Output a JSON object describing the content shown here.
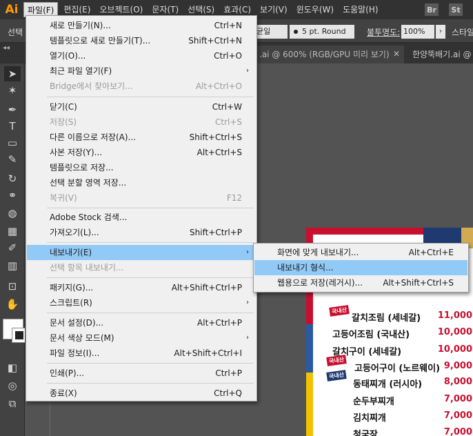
{
  "app": {
    "logo_text": "Ai"
  },
  "menubar": {
    "items": [
      {
        "label": "파일(F)",
        "active": true
      },
      {
        "label": "편집(E)"
      },
      {
        "label": "오브젝트(O)"
      },
      {
        "label": "문자(T)"
      },
      {
        "label": "선택(S)"
      },
      {
        "label": "효과(C)"
      },
      {
        "label": "보기(V)"
      },
      {
        "label": "윈도우(W)"
      },
      {
        "label": "도움말(H)"
      }
    ],
    "bridge_label": "Br",
    "stock_label": "St"
  },
  "controlbar": {
    "selection_label": "선택",
    "uniform_value": "균일",
    "brush_value": "5 pt. Round",
    "opacity_label": "불투명도:",
    "opacity_value": "100%",
    "style_label": "스타일"
  },
  "tabs": [
    {
      "label": ".ai @ 600% (RGB/GPU 미리 보기)"
    },
    {
      "label": "한양뚝배기.ai @"
    }
  ],
  "file_menu": {
    "items": [
      {
        "label": "새로 만들기(N)...",
        "shortcut": "Ctrl+N"
      },
      {
        "label": "템플릿으로 새로 만들기(T)...",
        "shortcut": "Shift+Ctrl+N"
      },
      {
        "label": "열기(O)...",
        "shortcut": "Ctrl+O"
      },
      {
        "label": "최근 파일 열기(F)",
        "shortcut": ""
      },
      {
        "label": "Bridge에서 찾아보기...",
        "shortcut": "Alt+Ctrl+O",
        "disabled": true
      },
      {
        "label": "닫기(C)",
        "shortcut": "Ctrl+W"
      },
      {
        "label": "저장(S)",
        "shortcut": "Ctrl+S",
        "disabled": true
      },
      {
        "label": "다른 이름으로 저장(A)...",
        "shortcut": "Shift+Ctrl+S"
      },
      {
        "label": "사본 저장(Y)...",
        "shortcut": "Alt+Ctrl+S"
      },
      {
        "label": "템플릿으로 저장...",
        "shortcut": ""
      },
      {
        "label": "선택 분할 영역 저장...",
        "shortcut": ""
      },
      {
        "label": "복귀(V)",
        "shortcut": "F12",
        "disabled": true
      },
      {
        "label": "Adobe Stock 검색...",
        "shortcut": ""
      },
      {
        "label": "가져오기(L)...",
        "shortcut": "Shift+Ctrl+P"
      },
      {
        "label": "내보내기(E)",
        "shortcut": ""
      },
      {
        "label": "선택 항목 내보내기...",
        "shortcut": "",
        "disabled": true
      },
      {
        "label": "패키지(G)...",
        "shortcut": "Alt+Shift+Ctrl+P"
      },
      {
        "label": "스크립트(R)",
        "shortcut": ""
      },
      {
        "label": "문서 설정(D)...",
        "shortcut": "Alt+Ctrl+P"
      },
      {
        "label": "문서 색상 모드(M)",
        "shortcut": ""
      },
      {
        "label": "파일 정보(I)...",
        "shortcut": "Alt+Shift+Ctrl+I"
      },
      {
        "label": "인쇄(P)...",
        "shortcut": "Ctrl+P"
      },
      {
        "label": "종료(X)",
        "shortcut": "Ctrl+Q"
      }
    ]
  },
  "export_submenu": {
    "items": [
      {
        "label": "화면에 맞게 내보내기...",
        "shortcut": "Alt+Ctrl+E"
      },
      {
        "label": "내보내기 형식...",
        "shortcut": ""
      },
      {
        "label": "웹용으로 저장(레거시)...",
        "shortcut": "Alt+Shift+Ctrl+S"
      }
    ]
  },
  "poster": {
    "stickers": [
      "국내산",
      "국내산",
      "국내산"
    ],
    "items": [
      {
        "name": "갈치조림 (세네갈)",
        "price": "11,000"
      },
      {
        "name": "고등어조림 (국내산)",
        "price": "10,000"
      },
      {
        "name": "갈치구이 (세네갈)",
        "price": "10,000"
      },
      {
        "name": "고등어구이 (노르웨이)",
        "price": "9,000"
      },
      {
        "name": "동태찌개 (러시아)",
        "price": "8,000"
      },
      {
        "name": "순두부찌개",
        "price": "7,000"
      },
      {
        "name": "김치찌개",
        "price": "7,000"
      },
      {
        "name": "청국장",
        "price": "7,000"
      }
    ]
  },
  "colors": {
    "accent_red": "#c8102e",
    "highlight": "#91c9f7",
    "app_orange": "#ff9a00"
  }
}
